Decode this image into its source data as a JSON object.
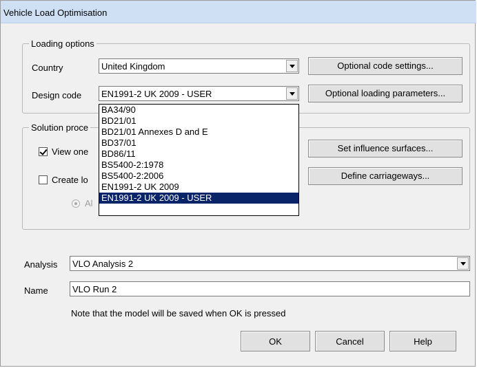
{
  "window": {
    "title": "Vehicle Load Optimisation"
  },
  "loading_options": {
    "group_label": "Loading options",
    "country_label": "Country",
    "country_value": "United Kingdom",
    "design_code_label": "Design code",
    "design_code_value": "EN1991-2 UK 2009 - USER",
    "optional_code_settings": "Optional code settings...",
    "optional_loading_parameters": "Optional loading parameters..."
  },
  "design_code_dropdown": {
    "options": [
      "BA34/90",
      "BD21/01",
      "BD21/01 Annexes D and E",
      "BD37/01",
      "BD86/11",
      "BS5400-2:1978",
      "BS5400-2:2006",
      "EN1991-2 UK 2009",
      "EN1991-2 UK 2009 - USER"
    ],
    "selected_index": 8
  },
  "solution_procedure": {
    "group_label": "Solution proce",
    "view_one_label": "View one",
    "view_one_checked": true,
    "create_label": "Create lo",
    "create_checked": false,
    "radio_label": "Al",
    "set_influence_surfaces": "Set influence surfaces...",
    "define_carriageways": "Define carriageways..."
  },
  "analysis": {
    "label": "Analysis",
    "value": "VLO Analysis 2"
  },
  "name": {
    "label": "Name",
    "value": "VLO Run 2"
  },
  "note": "Note that the model will be saved when OK is pressed",
  "buttons": {
    "ok": "OK",
    "cancel": "Cancel",
    "help": "Help"
  },
  "colors": {
    "titlebar": "#cfe0f4",
    "selection": "#0a246a",
    "dialog_bg": "#f0f0f0"
  }
}
